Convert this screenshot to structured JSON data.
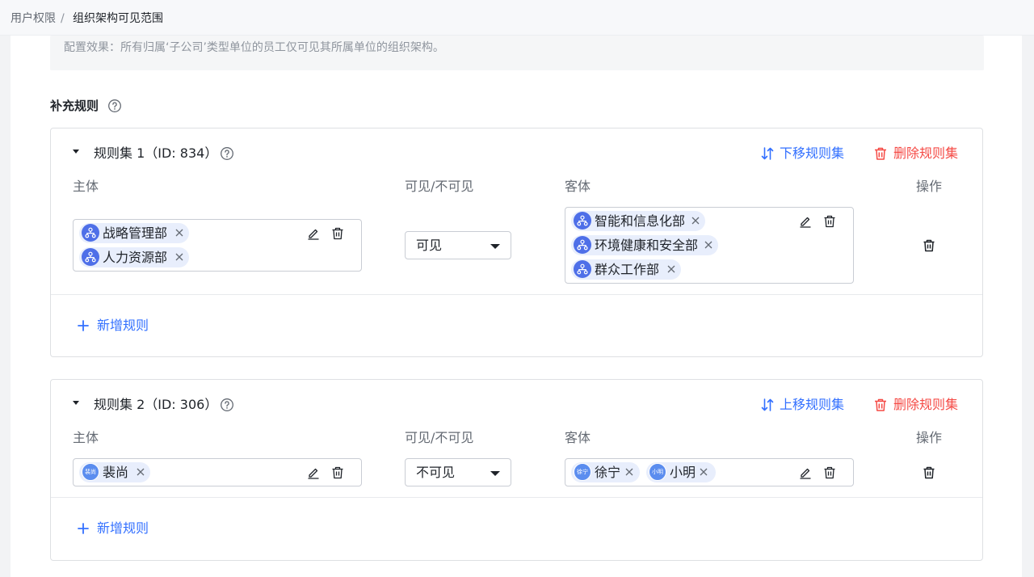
{
  "breadcrumb": {
    "parent": "用户权限",
    "separator": "/",
    "current": "组织架构可见范围"
  },
  "effect_text": "配置效果：所有归属‘子公司’类型单位的员工仅可见其所属单位的组织架构。",
  "section_title": "补充规则",
  "columns": {
    "subject": "主体",
    "visibility": "可见/不可见",
    "object": "客体",
    "operation": "操作"
  },
  "delete_ruleset_label": "删除规则集",
  "add_rule_label": "新增规则",
  "rulesets": [
    {
      "title": "规则集 1（ID: 834）",
      "move_label": "下移规则集",
      "subject_tags": [
        "战略管理部",
        "人力资源部"
      ],
      "visibility": "可见",
      "object_tags": [
        "智能和信息化部",
        "环境健康和安全部",
        "群众工作部"
      ]
    },
    {
      "title": "规则集 2（ID: 306）",
      "move_label": "上移规则集",
      "subject_tags": [
        "裴尚"
      ],
      "subject_avatars": [
        "裴尚"
      ],
      "visibility": "不可见",
      "object_tags": [
        "徐宁",
        "小明"
      ],
      "object_avatars": [
        "徐宁",
        "小明"
      ]
    }
  ],
  "colors": {
    "primary": "#3370ff",
    "danger": "#f54a45",
    "tag_bg": "#e8eefc",
    "org_avatar": "#4e6fe8"
  }
}
